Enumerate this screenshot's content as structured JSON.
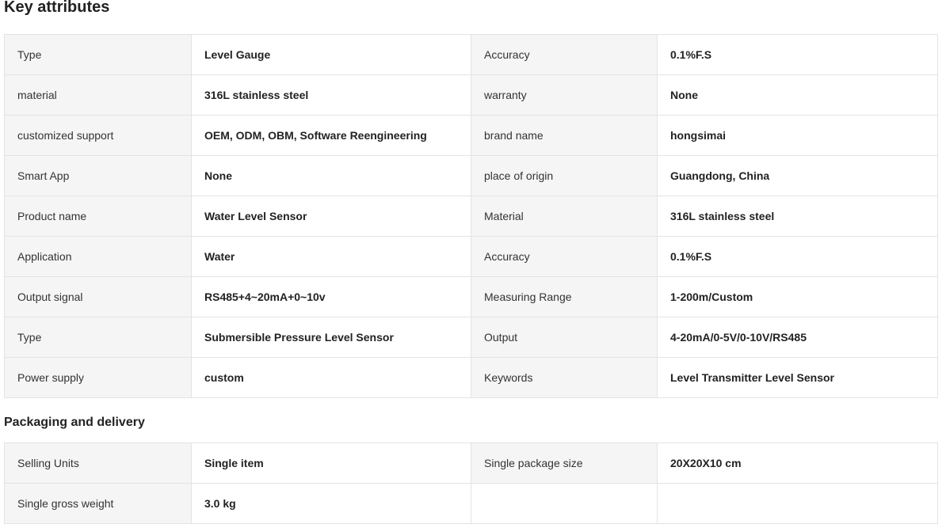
{
  "key_attributes": {
    "title": "Key attributes",
    "rows": [
      {
        "label1": "Type",
        "value1": "Level Gauge",
        "label2": "Accuracy",
        "value2": "0.1%F.S"
      },
      {
        "label1": "material",
        "value1": "316L stainless steel",
        "label2": "warranty",
        "value2": "None"
      },
      {
        "label1": "customized support",
        "value1": "OEM, ODM, OBM, Software Reengineering",
        "label2": "brand name",
        "value2": "hongsimai"
      },
      {
        "label1": "Smart App",
        "value1": "None",
        "label2": "place of origin",
        "value2": "Guangdong, China"
      },
      {
        "label1": "Product name",
        "value1": "Water Level Sensor",
        "label2": "Material",
        "value2": "316L stainless steel"
      },
      {
        "label1": "Application",
        "value1": "Water",
        "label2": "Accuracy",
        "value2": "0.1%F.S"
      },
      {
        "label1": "Output signal",
        "value1": "RS485+4~20mA+0~10v",
        "label2": "Measuring Range",
        "value2": "1-200m/Custom"
      },
      {
        "label1": "Type",
        "value1": "Submersible Pressure Level Sensor",
        "label2": "Output",
        "value2": "4-20mA/0-5V/0-10V/RS485"
      },
      {
        "label1": "Power supply",
        "value1": "custom",
        "label2": "Keywords",
        "value2": "Level Transmitter Level Sensor"
      }
    ]
  },
  "packaging": {
    "title": "Packaging and delivery",
    "rows": [
      {
        "label1": "Selling Units",
        "value1": "Single item",
        "label2": "Single package size",
        "value2": "20X20X10 cm"
      },
      {
        "label1": "Single gross weight",
        "value1": "3.0 kg",
        "label2": "",
        "value2": ""
      }
    ]
  }
}
